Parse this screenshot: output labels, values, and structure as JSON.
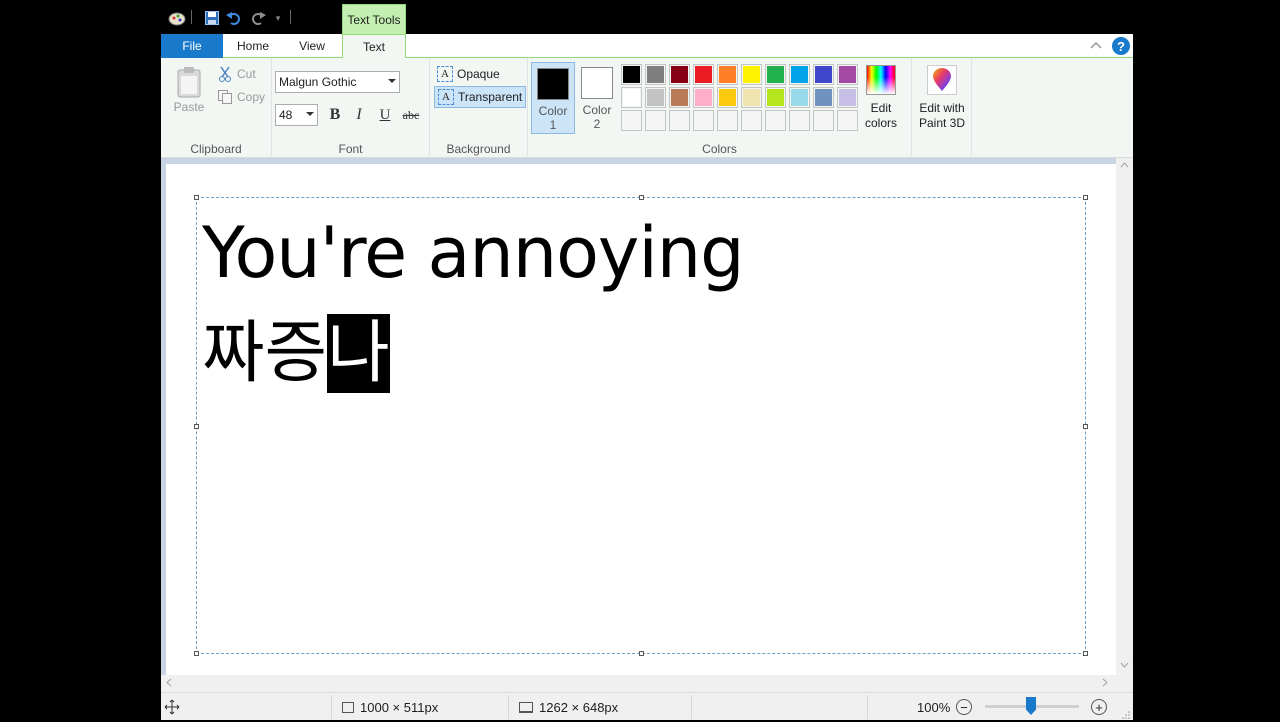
{
  "titlebar": {
    "contextual_tab": "Text Tools"
  },
  "tabs": {
    "file": "File",
    "home": "Home",
    "view": "View",
    "text": "Text"
  },
  "help": "?",
  "clipboard": {
    "paste": "Paste",
    "cut": "Cut",
    "copy": "Copy",
    "label": "Clipboard"
  },
  "font": {
    "family": "Malgun Gothic",
    "size": "48",
    "bold": "B",
    "italic": "I",
    "underline": "U",
    "strike": "abc",
    "label": "Font"
  },
  "background": {
    "opaque": "Opaque",
    "transparent": "Transparent",
    "label": "Background",
    "opaque_icon": "A",
    "transparent_icon": "A"
  },
  "colors": {
    "color1_label": "Color",
    "color1_num": "1",
    "color2_label": "Color",
    "color2_num": "2",
    "color1": "#000000",
    "color2": "#ffffff",
    "palette_row1": [
      "#000000",
      "#7f7f7f",
      "#880015",
      "#ed1c24",
      "#ff7f27",
      "#fff200",
      "#22b14c",
      "#00a2e8",
      "#3f48cc",
      "#a349a4"
    ],
    "palette_row2": [
      "#ffffff",
      "#c3c3c3",
      "#b97a57",
      "#ffaec9",
      "#ffc90e",
      "#efe4b0",
      "#b5e61d",
      "#99d9ea",
      "#7092be",
      "#c8bfe7"
    ],
    "palette_row3": [
      "#f5f5f5",
      "#f5f5f5",
      "#f5f5f5",
      "#f5f5f5",
      "#f5f5f5",
      "#f5f5f5",
      "#f5f5f5",
      "#f5f5f5",
      "#f5f5f5",
      "#f5f5f5"
    ],
    "edit_colors_1": "Edit",
    "edit_colors_2": "colors",
    "label": "Colors"
  },
  "paint3d": {
    "line1": "Edit with",
    "line2": "Paint 3D"
  },
  "canvas_text": {
    "line1": "You're annoying",
    "line2_normal": "짜증",
    "line2_selected": "나"
  },
  "status": {
    "selection_size": "1000 × 511px",
    "image_size": "1262 × 648px",
    "zoom": "100%",
    "zoom_out": "−",
    "zoom_in": "+"
  }
}
